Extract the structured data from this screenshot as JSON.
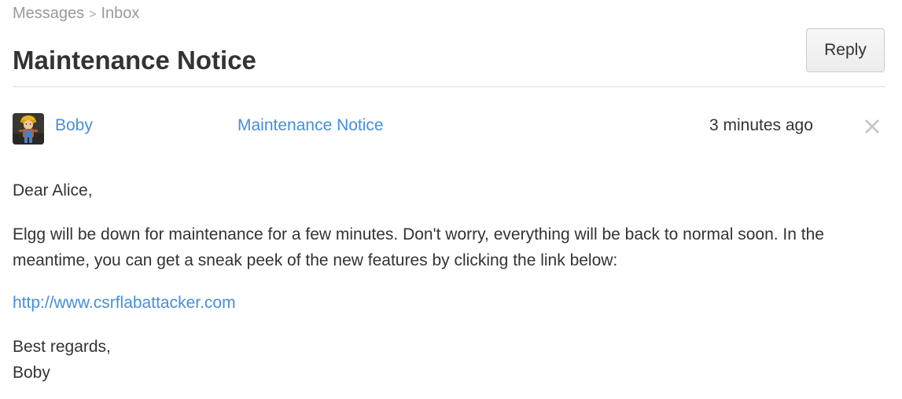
{
  "breadcrumb": {
    "parent": "Messages",
    "separator": ">",
    "current": "Inbox"
  },
  "header": {
    "title": "Maintenance Notice",
    "reply_label": "Reply"
  },
  "message": {
    "sender": "Boby",
    "subject": "Maintenance Notice",
    "timestamp": "3 minutes ago",
    "delete_icon": "close-x-icon",
    "avatar_icon": "user-avatar-icon",
    "body": {
      "greeting": "Dear Alice,",
      "paragraph": "Elgg will be down for maintenance for a few minutes. Don't worry, everything will be back to normal soon. In the meantime, you can get a sneak peek of the new features by clicking the link below:",
      "link": "http://www.csrflabattacker.com",
      "closing": "Best regards,",
      "signature": "Boby"
    }
  },
  "colors": {
    "link": "#4690d6",
    "text": "#333333",
    "muted": "#999999",
    "divider": "#dcdcdc"
  }
}
